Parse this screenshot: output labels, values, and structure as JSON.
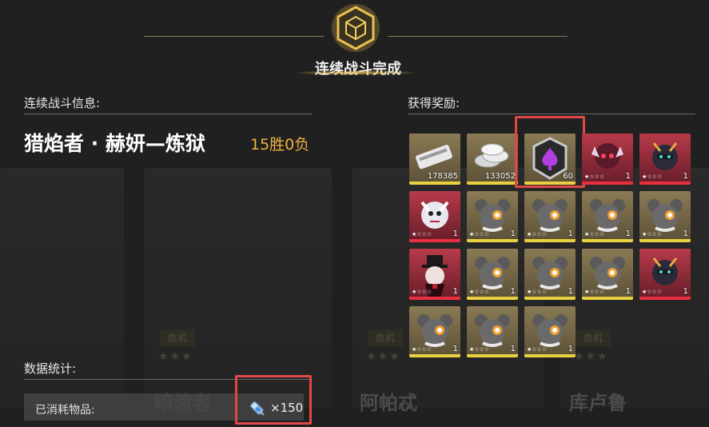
{
  "header": {
    "title": "连续战斗完成"
  },
  "left": {
    "info_title": "连续战斗信息:",
    "stage_name": "猎焰者 · 赫妍—炼狱",
    "result": "15胜0负",
    "stats_title": "数据统计:",
    "consumed_label": "已消耗物品:",
    "consumed_qty": "×150"
  },
  "background_cards": [
    {
      "name": "暗渡者",
      "badge": "危机",
      "stars": "★★★"
    },
    {
      "name": "阿帕忒",
      "badge": "危机",
      "stars": "★★★"
    },
    {
      "name": "库卢鲁",
      "badge": "危机",
      "stars": "★★★"
    }
  ],
  "rewards": {
    "title": "获得奖励:",
    "items": [
      {
        "kind": "ticket",
        "frame": "gold",
        "qty": "178385"
      },
      {
        "kind": "coins",
        "frame": "gold",
        "qty": "133052"
      },
      {
        "kind": "spade-token",
        "frame": "gold",
        "qty": "60",
        "highlighted": true
      },
      {
        "kind": "character-red-demon",
        "frame": "red",
        "qty": "1",
        "rank": "★☆☆☆"
      },
      {
        "kind": "character-dark-mask",
        "frame": "red",
        "qty": "1",
        "rank": "★☆☆☆"
      },
      {
        "kind": "character-white-beast",
        "frame": "red",
        "qty": "1",
        "rank": "★☆☆☆"
      },
      {
        "kind": "character-mouse",
        "frame": "gold",
        "qty": "1",
        "rank": "★☆☆☆"
      },
      {
        "kind": "character-mouse",
        "frame": "gold",
        "qty": "1",
        "rank": "★☆☆☆"
      },
      {
        "kind": "character-mouse",
        "frame": "gold",
        "qty": "1",
        "rank": "★☆☆☆"
      },
      {
        "kind": "character-mouse",
        "frame": "gold",
        "qty": "1",
        "rank": "★☆☆☆"
      },
      {
        "kind": "character-top-hat",
        "frame": "red",
        "qty": "1",
        "rank": "★☆☆☆"
      },
      {
        "kind": "character-mouse",
        "frame": "gold",
        "qty": "1",
        "rank": "★☆☆☆"
      },
      {
        "kind": "character-mouse",
        "frame": "gold",
        "qty": "1",
        "rank": "★☆☆☆"
      },
      {
        "kind": "character-mouse",
        "frame": "gold",
        "qty": "1",
        "rank": "★☆☆☆"
      },
      {
        "kind": "character-dark-mask",
        "frame": "red",
        "qty": "1",
        "rank": "★☆☆☆"
      },
      {
        "kind": "character-mouse",
        "frame": "gold",
        "qty": "1",
        "rank": "★☆☆☆"
      },
      {
        "kind": "character-mouse",
        "frame": "gold",
        "qty": "1",
        "rank": "★☆☆☆"
      },
      {
        "kind": "character-mouse",
        "frame": "gold",
        "qty": "1",
        "rank": "★☆☆☆"
      }
    ]
  },
  "colors": {
    "accent": "#f0b040",
    "highlight": "#e04848",
    "gold_frame": "#e8d040",
    "red_frame": "#e83040"
  }
}
